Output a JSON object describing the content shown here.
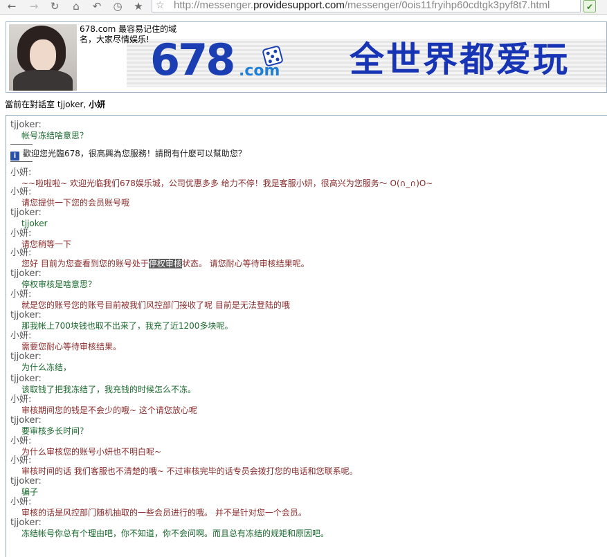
{
  "browser": {
    "url_prefix": "http://messenger.",
    "url_domain": "providesupport.com",
    "url_path": "/messenger/0ois11fryihp60cdtgk3pyf8t7.html"
  },
  "banner": {
    "tagline": "678.com 最容易记住的域名，大家尽情娱乐!",
    "logo_text": "678",
    "logo_com": ".com",
    "slogan": "全世界都爱玩"
  },
  "room": {
    "label": "當前在對話室",
    "participant_1": "tjjoker",
    "separator": ",",
    "participant_2": "小妍"
  },
  "transcript": {
    "first_message": {
      "sender": "tjjoker:",
      "text": "帐号冻结啥意思？"
    },
    "system_message": "歡迎您光臨678，很高興為您服務！請問有什麽可以幫助您？",
    "messages": [
      {
        "sender": "小妍:",
        "text": "~~啦啦啦~ 欢迎光临我们678娱乐城，公司优惠多多 给力不停！我是客服小妍，很高兴为您服务～ O(∩_∩)O~"
      },
      {
        "sender": "小妍:",
        "text": "请您提供一下您的会员账号哦"
      },
      {
        "sender": "tjjoker:",
        "text": "tjjoker"
      },
      {
        "sender": "小妍:",
        "text": "请您稍等一下"
      },
      {
        "sender": "小妍:",
        "text_before": "您好  目前为您查看到您的账号处于",
        "text_highlight": "停权审核",
        "text_after": "状态。  请您耐心等待审核结果呢。"
      },
      {
        "sender": "tjjoker:",
        "text": "停权审核是啥意思？"
      },
      {
        "sender": "小妍:",
        "text": "就是您的账号您的账号目前被我们风控部门接收了呢  目前是无法登陆的哦"
      },
      {
        "sender": "tjjoker:",
        "text": "那我帐上700块钱也取不出来了，我充了近1200多块呢。"
      },
      {
        "sender": "小妍:",
        "text": "需要您耐心等待审核结果。"
      },
      {
        "sender": "tjjoker:",
        "text": "为什么冻结，"
      },
      {
        "sender": "tjjoker:",
        "text": "该取钱了把我冻结了，我充钱的时候怎么不冻。"
      },
      {
        "sender": "小妍:",
        "text": "审核期间您的钱是不会少的哦~  这个请您放心呢"
      },
      {
        "sender": "tjjoker:",
        "text": "要审核多长时间？"
      },
      {
        "sender": "小妍:",
        "text": "为什么审核您的账号小妍也不明白呢~"
      },
      {
        "sender": "小妍:",
        "text": "审核时间的话 我们客服也不清楚的哦~   不过审核完毕的话专员会拨打您的电话和您联系呢。"
      },
      {
        "sender": "tjjoker:",
        "text": "骗子"
      },
      {
        "sender": "小妍:",
        "text": "审核的话是风控部门随机抽取的一些会员进行的哦。  并不是针对您一个会员。"
      },
      {
        "sender": "tjjoker:",
        "text": "冻结帐号你总有个理由吧，你不知道，你不会问啊。而且总有冻结的规矩和原因吧。"
      }
    ]
  },
  "colors": {
    "client_text": "#19682c",
    "operator_text": "#8b2a2a",
    "logo_blue": "#1b3fb3",
    "slogan_blue": "#1734b5"
  }
}
